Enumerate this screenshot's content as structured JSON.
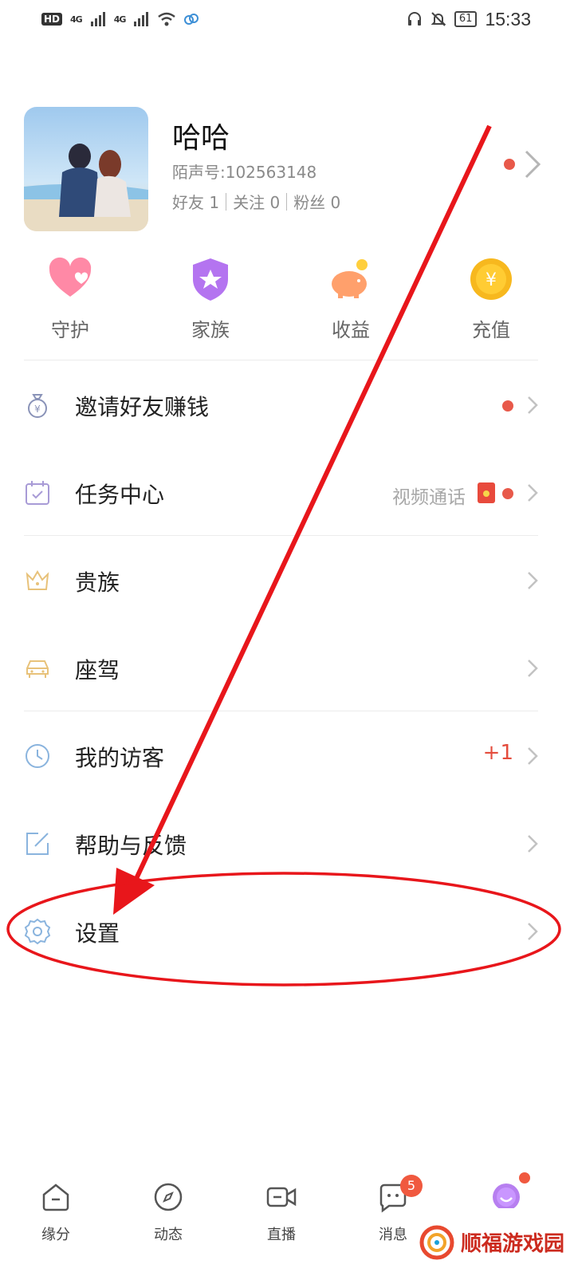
{
  "status_bar": {
    "hd_label": "HD",
    "signal_1": "4G",
    "signal_2": "4G",
    "battery": "61",
    "time": "15:33"
  },
  "profile": {
    "nickname": "哈哈",
    "account_id": "陌声号:102563148",
    "friends": "好友 1",
    "following": "关注 0",
    "followers": "粉丝 0"
  },
  "quick_actions": [
    {
      "label": "守护",
      "icon": "heart-icon",
      "color": "#ff7a9c"
    },
    {
      "label": "家族",
      "icon": "shield-star-icon",
      "color": "#b16cf2"
    },
    {
      "label": "收益",
      "icon": "piggy-bank-icon",
      "color": "#ff9e66"
    },
    {
      "label": "充值",
      "icon": "yuan-coin-icon",
      "color": "#f5b524"
    }
  ],
  "menu": [
    {
      "label": "邀请好友赚钱",
      "icon": "money-bag-icon"
    },
    {
      "label": "任务中心",
      "icon": "calendar-check-icon",
      "note": "视频通话"
    },
    {
      "label": "贵族",
      "icon": "crown-icon"
    },
    {
      "label": "座驾",
      "icon": "car-icon"
    },
    {
      "label": "我的访客",
      "icon": "clock-icon",
      "count": "+1"
    },
    {
      "label": "帮助与反馈",
      "icon": "edit-icon"
    },
    {
      "label": "设置",
      "icon": "gear-icon"
    }
  ],
  "bottom_nav": [
    {
      "label": "缘分",
      "icon": "home-icon"
    },
    {
      "label": "动态",
      "icon": "compass-icon"
    },
    {
      "label": "直播",
      "icon": "video-camera-icon"
    },
    {
      "label": "消息",
      "icon": "chat-bubble-icon",
      "badge": "5"
    },
    {
      "label": "",
      "icon": "me-avatar-icon"
    }
  ],
  "watermark": {
    "text": "顺福游戏园"
  },
  "colors": {
    "accent_red": "#e8594a",
    "annotation_red": "#e8161b"
  }
}
